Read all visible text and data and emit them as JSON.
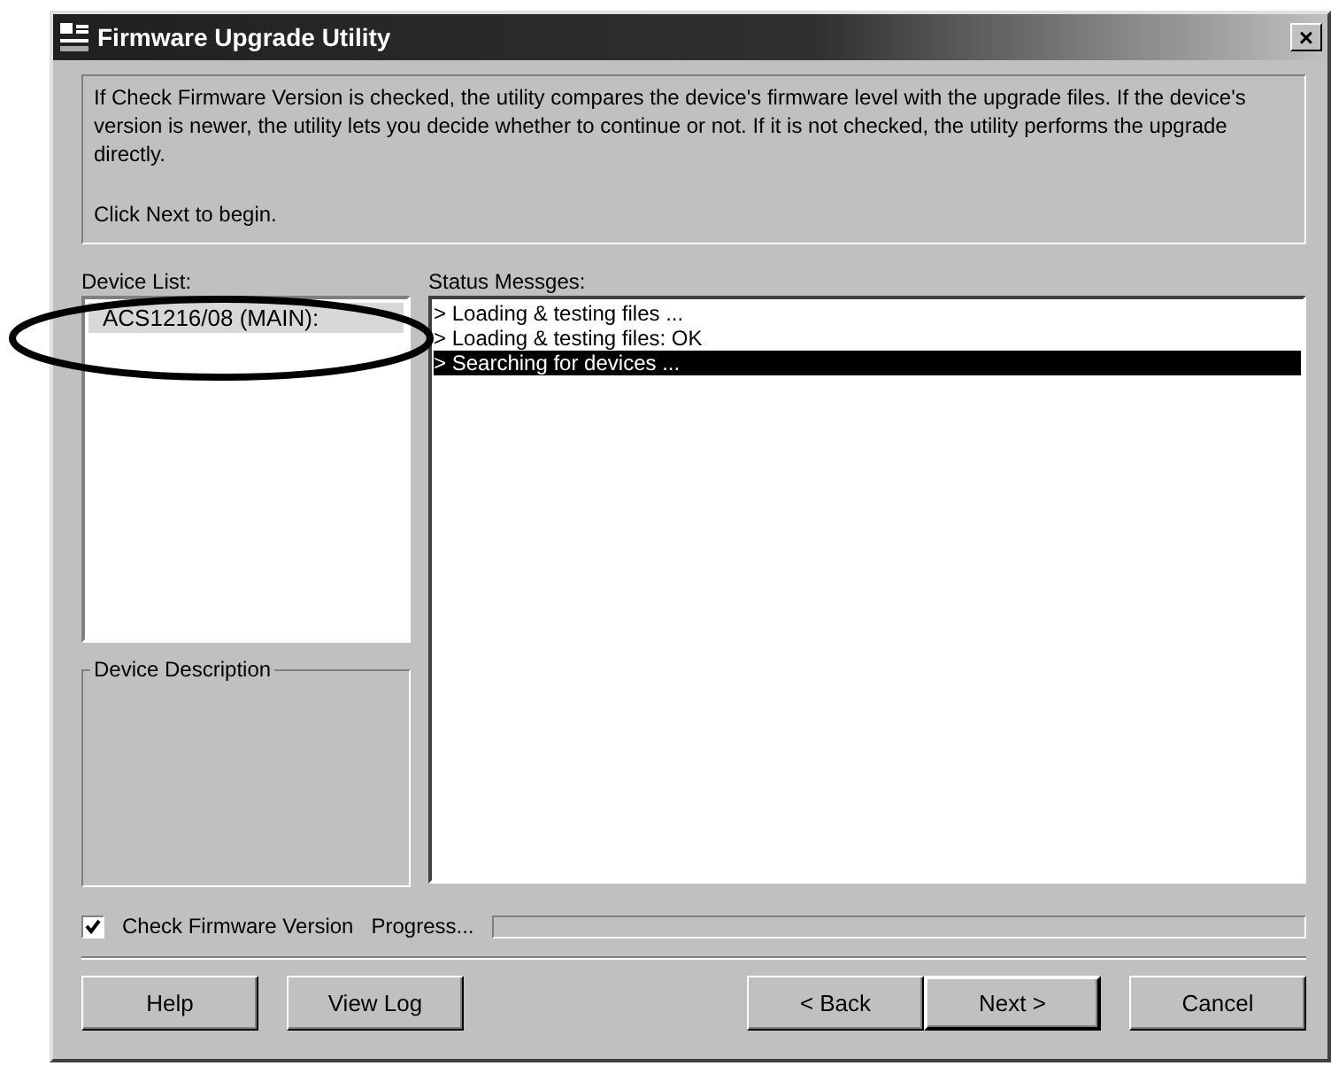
{
  "window": {
    "title": "Firmware Upgrade Utility",
    "close": "×"
  },
  "info": {
    "text": "If Check Firmware Version is checked, the utility compares the device's firmware level with the upgrade files. If the device's version is newer, the utility lets you decide whether to continue or not. If it is not checked, the utility performs the upgrade directly.",
    "hint": "Click Next to begin."
  },
  "device_list": {
    "label": "Device List:",
    "items": [
      {
        "label": "ACS1216/08 (MAIN):",
        "selected": true
      }
    ]
  },
  "device_description": {
    "label": "Device Description"
  },
  "status": {
    "label": "Status Messges:",
    "messages": [
      {
        "text": "> Loading & testing files ...",
        "selected": false
      },
      {
        "text": "> Loading & testing files: OK",
        "selected": false
      },
      {
        "text": "> Searching for devices ...",
        "selected": true
      }
    ]
  },
  "check_firmware": {
    "label": "Check Firmware Version",
    "checked": true
  },
  "progress": {
    "label": "Progress...",
    "level": 0
  },
  "left_buttons": [
    {
      "label": "Help",
      "default": false
    },
    {
      "label": "View Log",
      "default": false
    }
  ],
  "wizard_buttons": [
    {
      "label": "< Back",
      "default": false
    },
    {
      "label": "Next >",
      "default": true
    }
  ],
  "cancel_button": {
    "label": "Cancel",
    "default": false
  }
}
